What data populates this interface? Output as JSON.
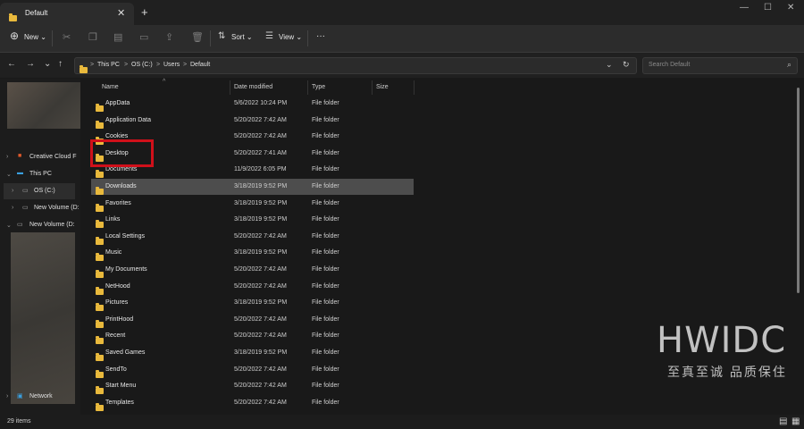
{
  "window": {
    "tab_title": "Default",
    "new_tab": "+",
    "tab_close": "✕",
    "minimize": "—",
    "maximize": "☐",
    "close": "✕"
  },
  "toolbar": {
    "new_label": "New",
    "sort_label": "Sort",
    "view_label": "View",
    "more_label": "···",
    "icons": [
      "new-icon",
      "cut-icon",
      "copy-icon",
      "paste-icon",
      "rename-icon",
      "share-icon",
      "delete-icon",
      "sort-icon",
      "view-icon",
      "more-icon"
    ]
  },
  "address": {
    "crumbs": [
      "This PC",
      "OS (C:)",
      "Users",
      "Default"
    ],
    "separator": ">",
    "search_placeholder": "Search Default"
  },
  "sidebar": {
    "items": [
      {
        "label": "Creative Cloud F"
      },
      {
        "label": "This PC"
      },
      {
        "label": "OS (C:)"
      },
      {
        "label": "New Volume (D:"
      },
      {
        "label": "New Volume (D:"
      },
      {
        "label": "Network"
      }
    ]
  },
  "columns": {
    "name": "Name",
    "date": "Date modified",
    "type": "Type",
    "size": "Size"
  },
  "files": [
    {
      "name": "AppData",
      "date": "5/6/2022 10:24 PM",
      "type": "File folder"
    },
    {
      "name": "Application Data",
      "date": "5/20/2022 7:42 AM",
      "type": "File folder"
    },
    {
      "name": "Cookies",
      "date": "5/20/2022 7:42 AM",
      "type": "File folder"
    },
    {
      "name": "Desktop",
      "date": "5/20/2022 7:41 AM",
      "type": "File folder"
    },
    {
      "name": "Documents",
      "date": "11/9/2022 6:05 PM",
      "type": "File folder"
    },
    {
      "name": "Downloads",
      "date": "3/18/2019 9:52 PM",
      "type": "File folder",
      "selected": true
    },
    {
      "name": "Favorites",
      "date": "3/18/2019 9:52 PM",
      "type": "File folder"
    },
    {
      "name": "Links",
      "date": "3/18/2019 9:52 PM",
      "type": "File folder"
    },
    {
      "name": "Local Settings",
      "date": "5/20/2022 7:42 AM",
      "type": "File folder"
    },
    {
      "name": "Music",
      "date": "3/18/2019 9:52 PM",
      "type": "File folder"
    },
    {
      "name": "My Documents",
      "date": "5/20/2022 7:42 AM",
      "type": "File folder"
    },
    {
      "name": "NetHood",
      "date": "5/20/2022 7:42 AM",
      "type": "File folder"
    },
    {
      "name": "Pictures",
      "date": "3/18/2019 9:52 PM",
      "type": "File folder"
    },
    {
      "name": "PrintHood",
      "date": "5/20/2022 7:42 AM",
      "type": "File folder"
    },
    {
      "name": "Recent",
      "date": "5/20/2022 7:42 AM",
      "type": "File folder"
    },
    {
      "name": "Saved Games",
      "date": "3/18/2019 9:52 PM",
      "type": "File folder"
    },
    {
      "name": "SendTo",
      "date": "5/20/2022 7:42 AM",
      "type": "File folder"
    },
    {
      "name": "Start Menu",
      "date": "5/20/2022 7:42 AM",
      "type": "File folder"
    },
    {
      "name": "Templates",
      "date": "5/20/2022 7:42 AM",
      "type": "File folder"
    }
  ],
  "status": {
    "count": "29 items"
  },
  "watermark": {
    "brand": "HWIDC",
    "tagline": "至真至诚 品质保住"
  },
  "colors": {
    "folder": "#e9b93c",
    "highlight": "#d0101a",
    "selected_row": "#4d4d4d",
    "background": "#191919"
  }
}
